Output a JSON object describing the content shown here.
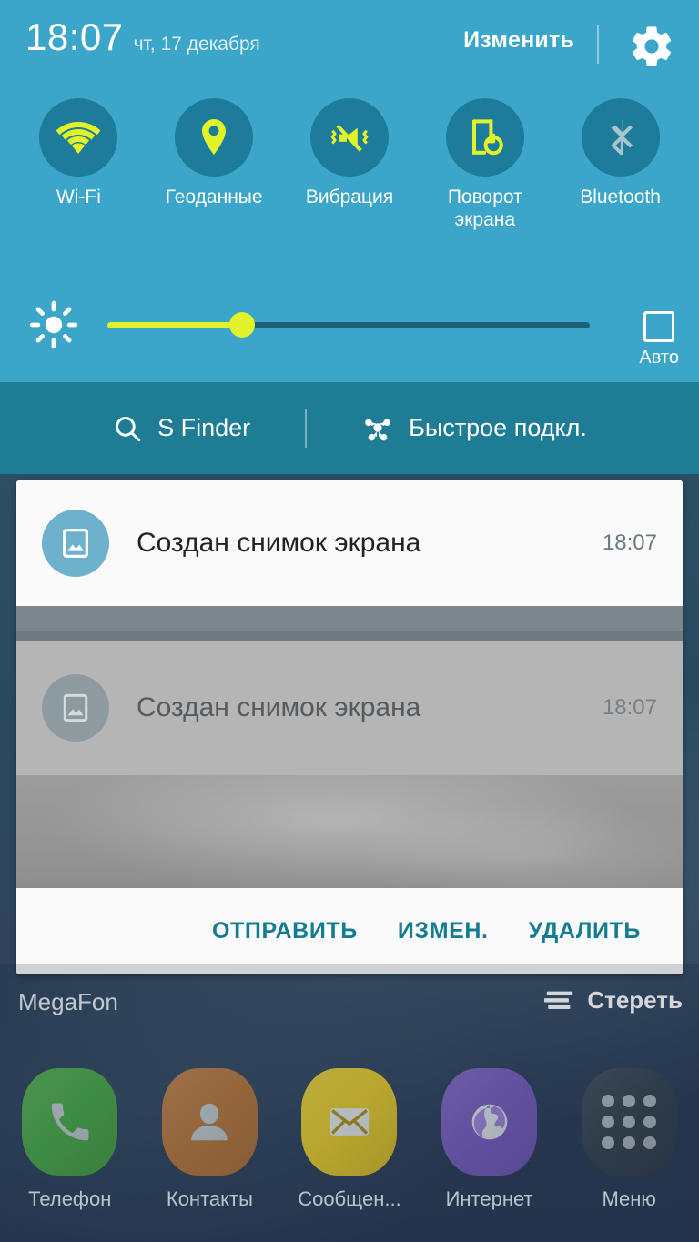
{
  "status": {
    "time": "18:07",
    "date": "чт, 17 декабря",
    "edit_label": "Изменить",
    "gear_icon": "gear-icon"
  },
  "quick_toggles": [
    {
      "label": "Wi-Fi",
      "icon": "wifi-icon",
      "active": true
    },
    {
      "label": "Геоданные",
      "icon": "location-icon",
      "active": true
    },
    {
      "label": "Вибрация",
      "icon": "vibrate-icon",
      "active": true
    },
    {
      "label": "Поворот экрана",
      "icon": "screen-rotation-icon",
      "active": true
    },
    {
      "label": "Bluetooth",
      "icon": "bluetooth-icon",
      "active": false
    }
  ],
  "brightness": {
    "icon": "brightness-sun-icon",
    "value": 28,
    "auto_label": "Авто",
    "auto_checked": false
  },
  "search_bar": {
    "s_finder_label": "S Finder",
    "s_finder_icon": "search-icon",
    "quick_connect_label": "Быстрое подкл.",
    "quick_connect_icon": "quick-connect-icon"
  },
  "notification": {
    "icon": "image-icon",
    "title": "Создан снимок экрана",
    "time": "18:07",
    "preview": {
      "title": "Создан снимок экрана",
      "time": "18:07",
      "icon": "image-icon"
    },
    "actions": [
      {
        "label": "ОТПРАВИТЬ",
        "name": "share"
      },
      {
        "label": "ИЗМЕН.",
        "name": "edit"
      },
      {
        "label": "УДАЛИТЬ",
        "name": "delete"
      }
    ]
  },
  "carrier": {
    "name": "MegaFon",
    "clear_label": "Стереть",
    "clear_icon": "clear-all-icon"
  },
  "dock": [
    {
      "label": "Телефон",
      "icon": "phone-icon",
      "color": "#3f8c44"
    },
    {
      "label": "Контакты",
      "icon": "contacts-icon",
      "color": "#95663c"
    },
    {
      "label": "Сообщен...",
      "icon": "messages-icon",
      "color": "#b8a62e"
    },
    {
      "label": "Интернет",
      "icon": "globe-icon",
      "color": "#6250a0"
    },
    {
      "label": "Меню",
      "icon": "apps-grid-icon",
      "color": "#2e3b49"
    }
  ],
  "colors": {
    "panel_bg": "#3ba6c9",
    "search_bg": "#1e7c95",
    "toggle_circle": "#1c7c99",
    "accent_yellow": "#e3f32a",
    "accent_teal": "#147c92",
    "inactive_icon": "#a8c4ce"
  }
}
